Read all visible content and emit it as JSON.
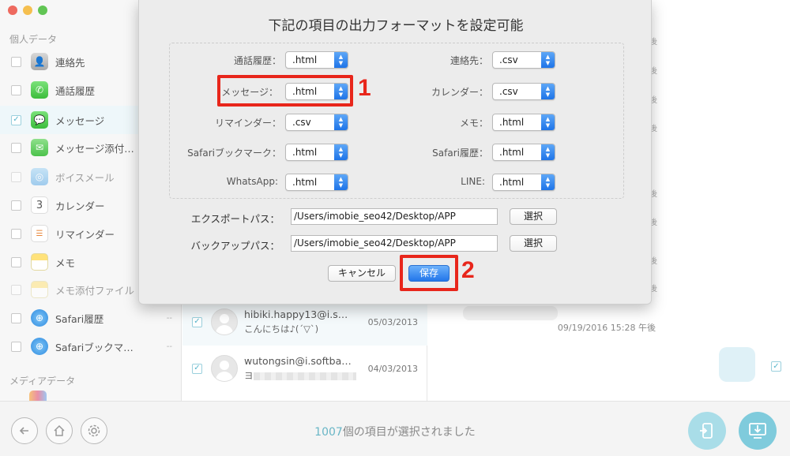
{
  "window": {
    "traffic_colors": [
      "#ee6a5f",
      "#f5bf4f",
      "#61c554"
    ]
  },
  "sidebar": {
    "section_personal": "個人データ",
    "section_media": "メディアデータ",
    "items": [
      {
        "label": "連絡先",
        "icon": "contacts-icon",
        "checked": false,
        "count": ""
      },
      {
        "label": "通話履歴",
        "icon": "phone-icon",
        "checked": false,
        "count": ""
      },
      {
        "label": "メッセージ",
        "icon": "messages-icon",
        "checked": true,
        "count": ""
      },
      {
        "label": "メッセージ添付…",
        "icon": "attachment-icon",
        "checked": false,
        "count": ""
      },
      {
        "label": "ボイスメール",
        "icon": "voicemail-icon",
        "checked": false,
        "count": ""
      },
      {
        "label": "カレンダー",
        "icon": "calendar-icon",
        "checked": false,
        "count": ""
      },
      {
        "label": "リマインダー",
        "icon": "reminders-icon",
        "checked": false,
        "count": ""
      },
      {
        "label": "メモ",
        "icon": "notes-icon",
        "checked": false,
        "count": ""
      },
      {
        "label": "メモ添付ファイル",
        "icon": "note-attachment-icon",
        "checked": false,
        "count": ""
      },
      {
        "label": "Safari履歴",
        "icon": "safari-icon",
        "checked": false,
        "count": "--"
      },
      {
        "label": "Safariブックマ…",
        "icon": "safari-bookmark-icon",
        "checked": false,
        "count": "--"
      }
    ]
  },
  "messages": [
    {
      "name": "hibiki.happy13@i.s…",
      "preview": "こんにちは♪(´▽`)",
      "date": "05/03/2013",
      "checked": true
    },
    {
      "name": "wutongsin@i.softba…",
      "preview": "ヨ",
      "date": "04/03/2013",
      "checked": true
    }
  ],
  "chat": {
    "timestamp": "09/19/2016 15:28 午後",
    "edge_marks": [
      "後",
      "後",
      "後",
      "後",
      "後",
      "後",
      "後",
      "後"
    ]
  },
  "dialog": {
    "title": "下記の項目の出力フォーマットを設定可能",
    "formats": [
      {
        "label": "通話履歴：",
        "value": ".html"
      },
      {
        "label": "連絡先：",
        "value": ".csv"
      },
      {
        "label": "メッセージ：",
        "value": ".html"
      },
      {
        "label": "カレンダー：",
        "value": ".csv"
      },
      {
        "label": "リマインダー：",
        "value": ".csv"
      },
      {
        "label": "メモ：",
        "value": ".html"
      },
      {
        "label": "Safariブックマーク：",
        "value": ".html"
      },
      {
        "label": "Safari履歴：",
        "value": ".html"
      },
      {
        "label": "WhatsApp:",
        "value": ".html"
      },
      {
        "label": "LINE:",
        "value": ".html"
      }
    ],
    "export_path_label": "エクスポートパス：",
    "export_path_value": "/Users/imobie_seo42/Desktop/APP",
    "backup_path_label": "バックアップパス：",
    "backup_path_value": "/Users/imobie_seo42/Desktop/APP",
    "select_label": "選択",
    "cancel_label": "キャンセル",
    "save_label": "保存"
  },
  "annotations": {
    "step1": "1",
    "step2": "2",
    "color": "#e8261b"
  },
  "bottom": {
    "selected_count": "1007",
    "selected_suffix": "個の項目が選択されました",
    "accent": "#69b6c6"
  }
}
